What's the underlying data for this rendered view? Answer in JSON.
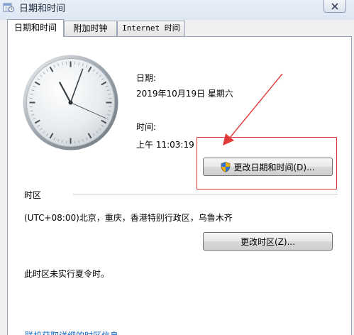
{
  "window": {
    "title": "日期和时间"
  },
  "tabs": [
    {
      "label": "日期和时间",
      "active": true
    },
    {
      "label": "附加时钟",
      "active": false
    },
    {
      "label": "Internet 时间",
      "active": false
    }
  ],
  "clock": {
    "hours": 11,
    "minutes": 3,
    "seconds": 19
  },
  "date_section": {
    "label": "日期:",
    "value": "2019年10月19日 星期六"
  },
  "time_section": {
    "label": "时间:",
    "value": "上午 11:03:19"
  },
  "buttons": {
    "change_datetime": "更改日期和时间(D)...",
    "change_timezone": "更改时区(Z)..."
  },
  "timezone": {
    "heading": "时区",
    "value": "(UTC+08:00)北京，重庆，香港特别行政区，乌鲁木齐",
    "dst_note": "此时区未实行夏令时。"
  },
  "footer": {
    "link_partial": "联机获取详细的时区信息"
  },
  "annotation": {
    "color": "#e23a3a"
  }
}
